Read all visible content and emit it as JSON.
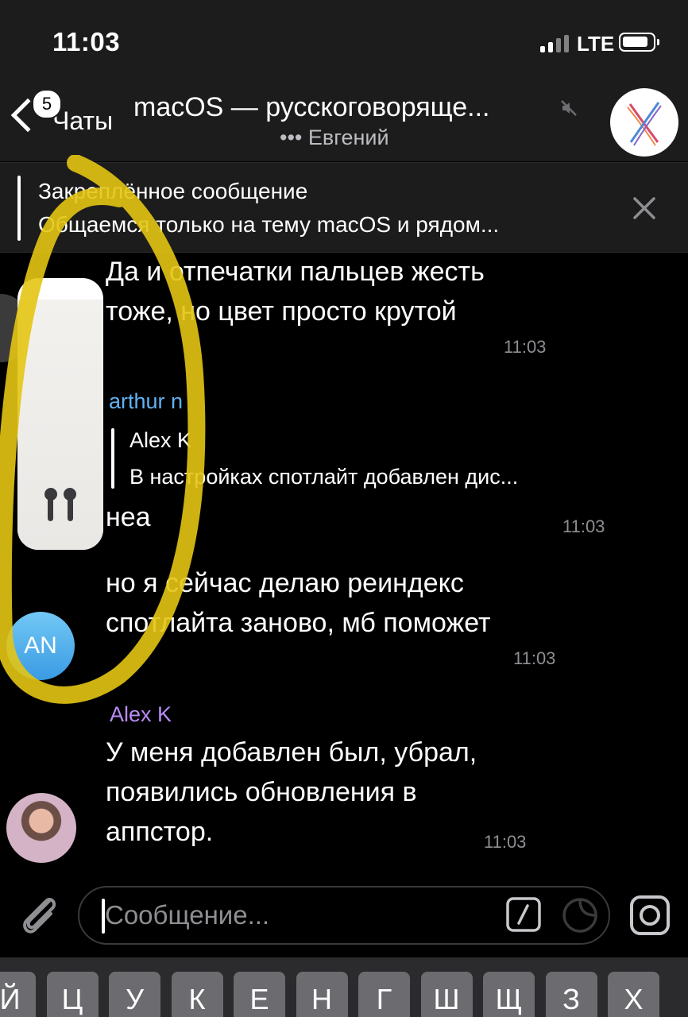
{
  "status_bar": {
    "time": "11:03",
    "carrier": "LTE",
    "battery_level": 0.85
  },
  "nav": {
    "back_label": "Чаты",
    "unread_count": "5",
    "title": "macOS — русскоговоряще...",
    "subtitle": "••• Евгений",
    "muted": true,
    "avatar_icon": "macos-x-logo"
  },
  "pinned": {
    "title": "Закреплённое сообщение",
    "text": "Общаемся только на тему macOS и рядом..."
  },
  "messages": [
    {
      "lines": [
        "Да и отпечатки пальцев жесть",
        "тоже, но цвет просто крутой"
      ],
      "time": "11:03"
    },
    {
      "sender": "arthur n",
      "sender_color": "#5fb3f5",
      "reply": {
        "author": "Alex K",
        "text": "В настройках спотлайт добавлен дис..."
      },
      "lines": [
        "неа"
      ],
      "time": "11:03"
    },
    {
      "lines": [
        "но я сейчас делаю реиндекс",
        "спотлайта заново, мб поможет"
      ],
      "time": "11:03",
      "avatar_initials": "AN"
    },
    {
      "sender": "Alex K",
      "sender_color": "#b98cf5",
      "lines": [
        "У меня добавлен был, убрал,",
        "появились обновления в",
        "аппстор."
      ],
      "time": "11:03"
    }
  ],
  "volume_hud": {
    "level": 0.92,
    "icon": "airpods-icon"
  },
  "composer": {
    "placeholder": "Сообщение..."
  },
  "keyboard": {
    "keys": [
      "Й",
      "Ц",
      "У",
      "К",
      "Е",
      "Н",
      "Г",
      "Ш",
      "Щ",
      "З",
      "Х"
    ]
  },
  "colors": {
    "accent_marker": "#e3c514",
    "bar_bg": "#1c1c1d",
    "time_gray": "#8e8e93"
  }
}
